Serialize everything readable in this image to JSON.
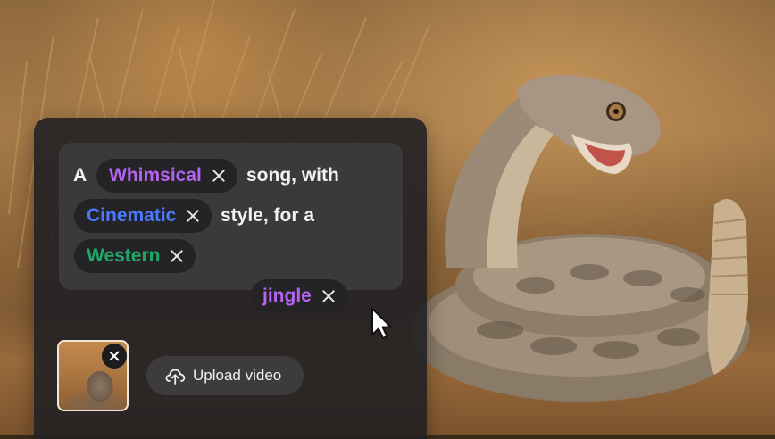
{
  "prompt": {
    "words": [
      "A",
      "song, with",
      "style, for a"
    ],
    "chips": [
      {
        "label": "Whimsical",
        "color": "#b464f0"
      },
      {
        "label": "Cinematic",
        "color": "#4a78ff"
      },
      {
        "label": "Western",
        "color": "#1fa86a"
      },
      {
        "label": "jingle",
        "color": "#b464f0"
      }
    ]
  },
  "attachments": {
    "upload_label": "Upload video",
    "upload_icon": "cloud-upload-icon",
    "remove_icon": "close-icon"
  },
  "cursor_icon": "mouse-pointer-icon"
}
